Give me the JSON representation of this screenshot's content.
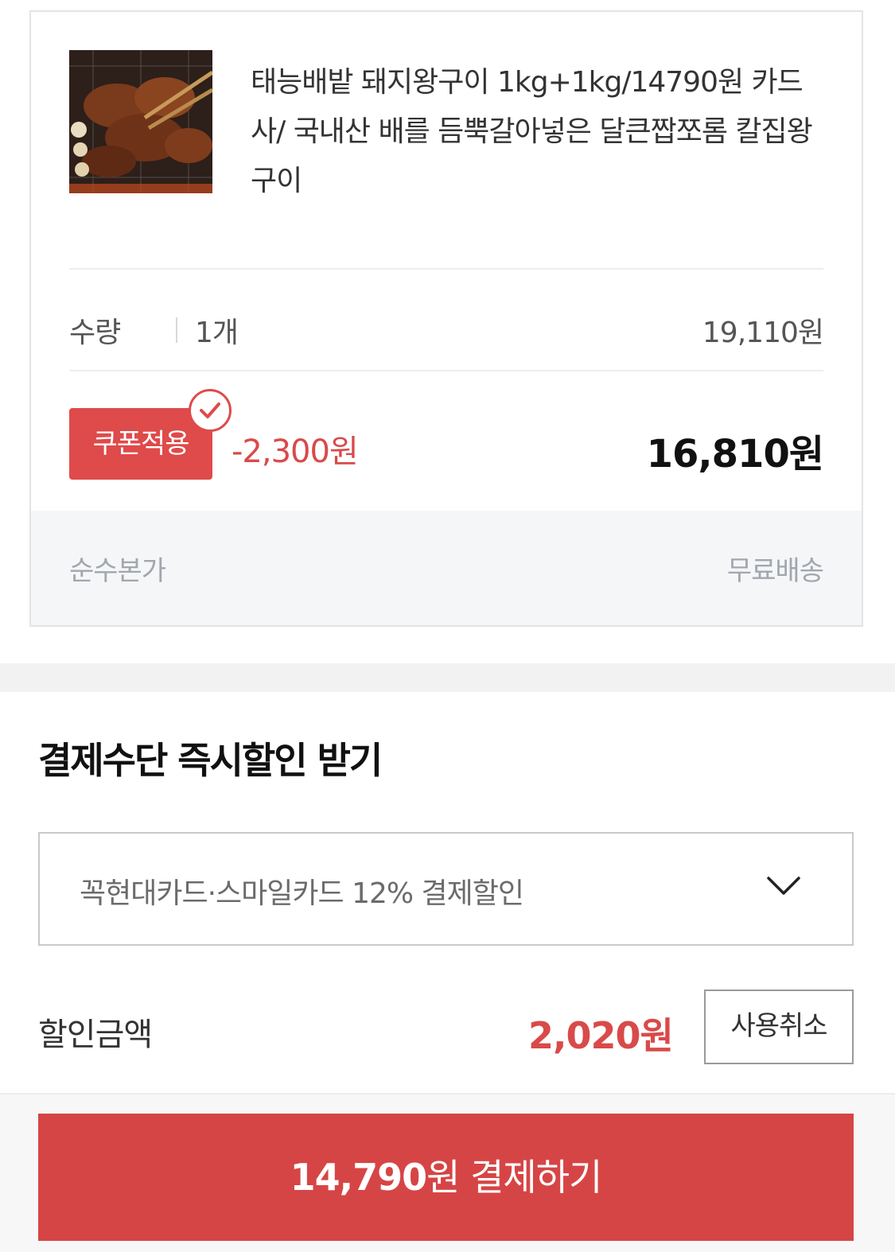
{
  "product": {
    "image": "grilled-pork-ribs-thumbnail",
    "title": "태능배밭 돼지왕구이 1kg+1kg/14790원 카드사/ 국내산 배를 듬뿍갈아넣은 달큰짭쪼롬 칼집왕구이"
  },
  "quantity": {
    "label": "수량",
    "value": "1개",
    "price": "19,110원"
  },
  "coupon": {
    "button_label": "쿠폰적용",
    "discount": "-2,300원",
    "total": "16,810원"
  },
  "footer": {
    "left": "순수본가",
    "right": "무료배송"
  },
  "payment_discount": {
    "title": "결제수단 즉시할인 받기",
    "selected_card": "꼭현대카드·스마일카드 12% 결제할인",
    "amount_label": "할인금액",
    "amount": "2,020원",
    "cancel_label": "사용취소"
  },
  "pay_button": {
    "amount": "14,790",
    "suffix": "원 결제하기"
  },
  "colors": {
    "accent": "#df4a4a",
    "pay_button": "#d64545",
    "footer_bg": "#f5f6f8"
  }
}
